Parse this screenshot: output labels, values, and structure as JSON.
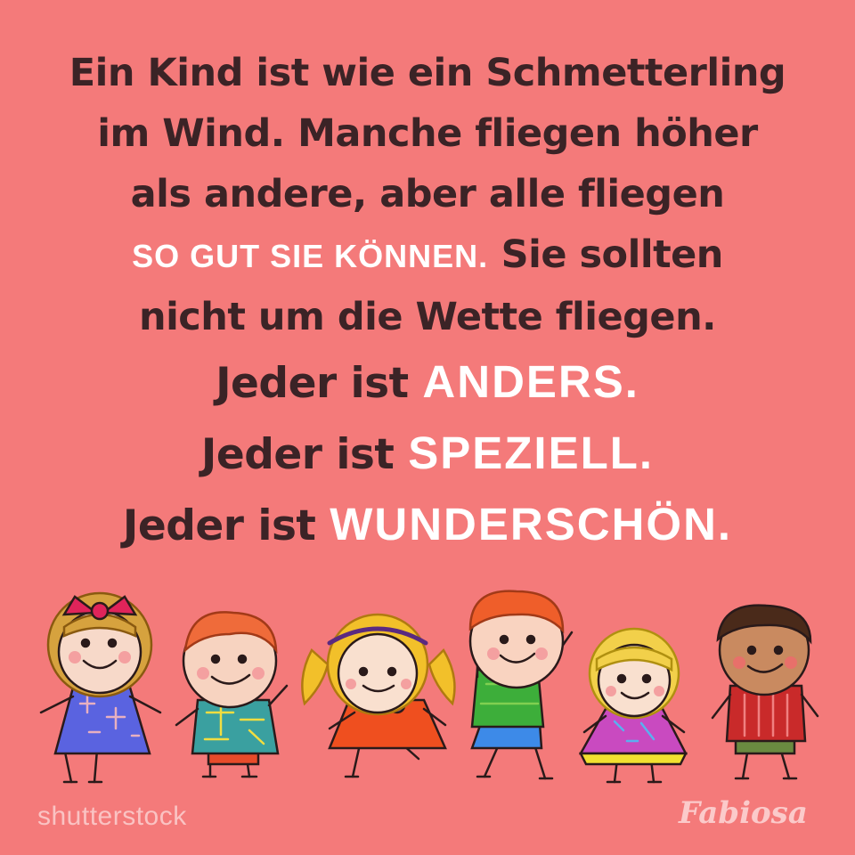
{
  "quote": {
    "line1": "Ein Kind ist wie ein Schmetterling",
    "line2": "im Wind. Manche fliegen höher",
    "line3": "als andere, aber alle fliegen",
    "line4_highlight": "SO GUT SIE KÖNNEN.",
    "line4_rest": " Sie sollten",
    "line5": "nicht um die Wette fliegen.",
    "jeder_prefix": "Jeder ist ",
    "word1": "ANDERS.",
    "word2": "SPEZIELL.",
    "word3": "WUNDERSCHÖN."
  },
  "colors": {
    "background": "#f47a7a",
    "text": "#3b2326",
    "highlight": "#ffffff"
  },
  "illustration": {
    "children": [
      "girl-with-red-bow",
      "boy-red-hair",
      "girl-yellow-pigtails",
      "boy-waving",
      "girl-blond",
      "boy-brown-hair"
    ]
  },
  "watermarks": {
    "left": "shutterstock",
    "right": "Fabiosa"
  }
}
